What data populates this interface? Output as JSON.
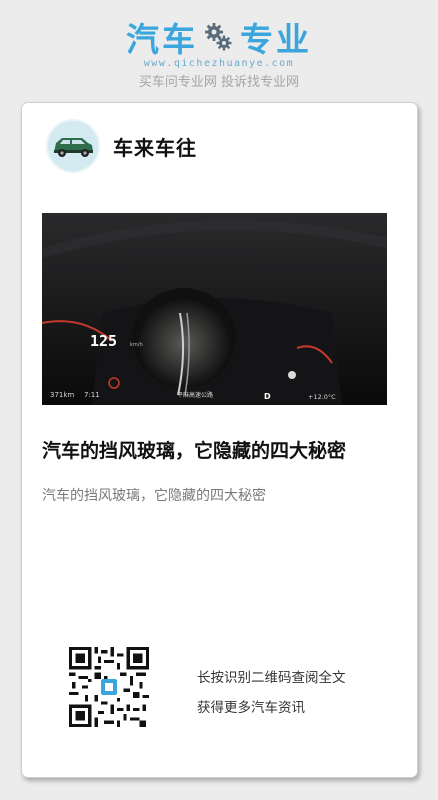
{
  "header": {
    "logo_left": "汽车",
    "logo_right": "专业",
    "logo_url": "www.qichezhuanye.com",
    "slogan": "买车问专业网 投诉找专业网"
  },
  "article": {
    "author": "车来车往",
    "title": "汽车的挡风玻璃，它隐藏的四大秘密",
    "summary": "汽车的挡风玻璃，它隐藏的四大秘密"
  },
  "photo": {
    "speed": "125",
    "speed_unit": "km/h",
    "range": "371km",
    "time": "7:11",
    "road": "平麻高速公路",
    "gear": "D",
    "temperature": "+12.0°C"
  },
  "share": {
    "line1": "长按识别二维码查阅全文",
    "line2": "获得更多汽车资讯"
  },
  "colors": {
    "brand": "#3aa6dd",
    "background": "#ececec"
  }
}
